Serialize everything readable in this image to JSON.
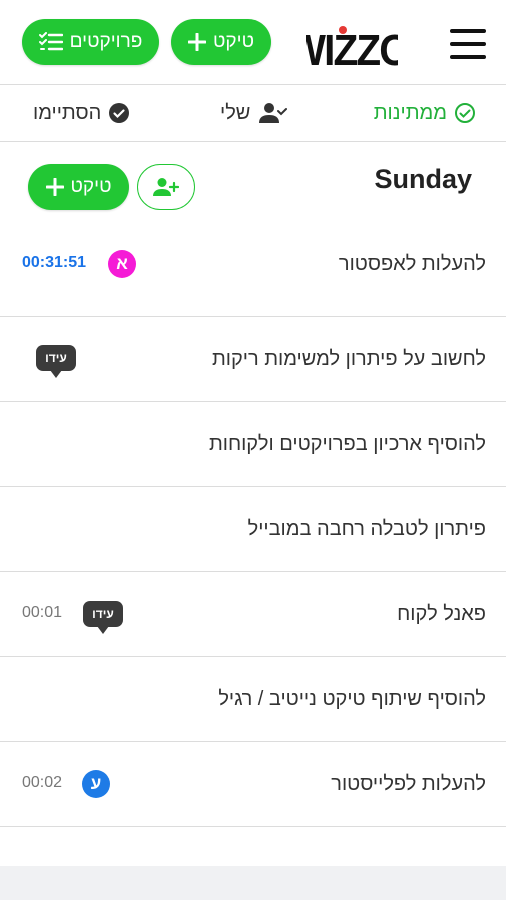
{
  "header": {
    "logo_text": "WIZZO",
    "menu_icon": "hamburger-icon",
    "ticket_button_label": "טיקט",
    "projects_button_label": "פרויקטים",
    "accent_color": "#22c734"
  },
  "tabs": [
    {
      "label": "ממתינות",
      "icon": "check-circle-icon",
      "active": true
    },
    {
      "label": "שלי",
      "icon": "user-check-icon",
      "active": false
    },
    {
      "label": "הסתיימו",
      "icon": "check-filled-icon",
      "active": false
    }
  ],
  "day": {
    "title": "Sunday",
    "ticket_button_label": "טיקט",
    "add_user_icon": "add-user-icon"
  },
  "tasks": [
    {
      "title": "להעלות לאפסטור",
      "timer": "00:31:51",
      "timer_active": true,
      "assignee": {
        "type": "avatar",
        "letter": "א",
        "color": "#f51bd6"
      }
    },
    {
      "title": "לחשוב על פיתרון למשימות ריקות",
      "timer": "",
      "assignee": {
        "type": "bubble",
        "name": "עידו"
      }
    },
    {
      "title": "להוסיף ארכיון בפרויקטים ולקוחות",
      "timer": "",
      "assignee": null
    },
    {
      "title": "פיתרון לטבלה רחבה במובייל",
      "timer": "",
      "assignee": null
    },
    {
      "title": "פאנל לקוח",
      "timer": "00:01",
      "assignee": {
        "type": "bubble",
        "name": "עידו"
      }
    },
    {
      "title": "להוסיף שיתוף טיקט נייטיב / רגיל",
      "timer": "",
      "assignee": null
    },
    {
      "title": "להעלות לפלייסטור",
      "timer": "00:02",
      "assignee": {
        "type": "avatar",
        "letter": "ע",
        "color": "#1e7be6"
      }
    }
  ]
}
